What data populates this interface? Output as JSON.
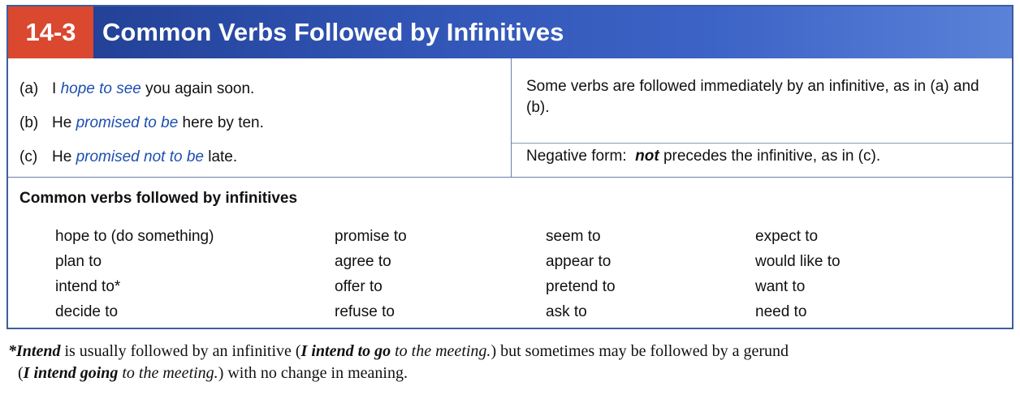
{
  "title": {
    "number": "14-3",
    "text": "Common Verbs Followed by Infinitives"
  },
  "examples": [
    {
      "tag": "(a)",
      "pre": "I",
      "highlight": "hope to see",
      "post": "you again soon."
    },
    {
      "tag": "(b)",
      "pre": "He",
      "highlight": "promised to be",
      "post": "here by ten."
    },
    {
      "tag": "(c)",
      "pre": "He",
      "highlight": "promised not to be",
      "post": "late."
    }
  ],
  "explanations": {
    "first": "Some verbs are followed immediately by an infinitive, as in (a) and (b).",
    "second_prefix": "Negative form:",
    "second_emphasis": "not",
    "second_suffix": "precedes the infinitive, as in (c)."
  },
  "verbs_heading": "Common verbs followed by infinitives",
  "verb_columns": [
    [
      "hope to (do something)",
      "plan to",
      "intend to*",
      "decide to"
    ],
    [
      "promise to",
      "agree to",
      "offer to",
      "refuse to"
    ],
    [
      "seem to",
      "appear to",
      "pretend to",
      "ask to"
    ],
    [
      "expect to",
      "would like to",
      "want to",
      "need to"
    ]
  ],
  "footnote": {
    "star": "*",
    "word": "Intend",
    "t1": "is usually followed by an infinitive (",
    "ex1_bold": "I intend to go",
    "ex1_rest": "to the meeting.",
    "t2": ") but sometimes may be followed by a gerund",
    "t3": "(",
    "ex2_bold": "I intend going",
    "ex2_rest": "to the meeting.",
    "t4": ") with no change in meaning."
  },
  "colors": {
    "title_number_bg": "#d9482f",
    "title_bar": "#3155b5",
    "highlight": "#1d4fae",
    "border": "#3d5ea0"
  }
}
